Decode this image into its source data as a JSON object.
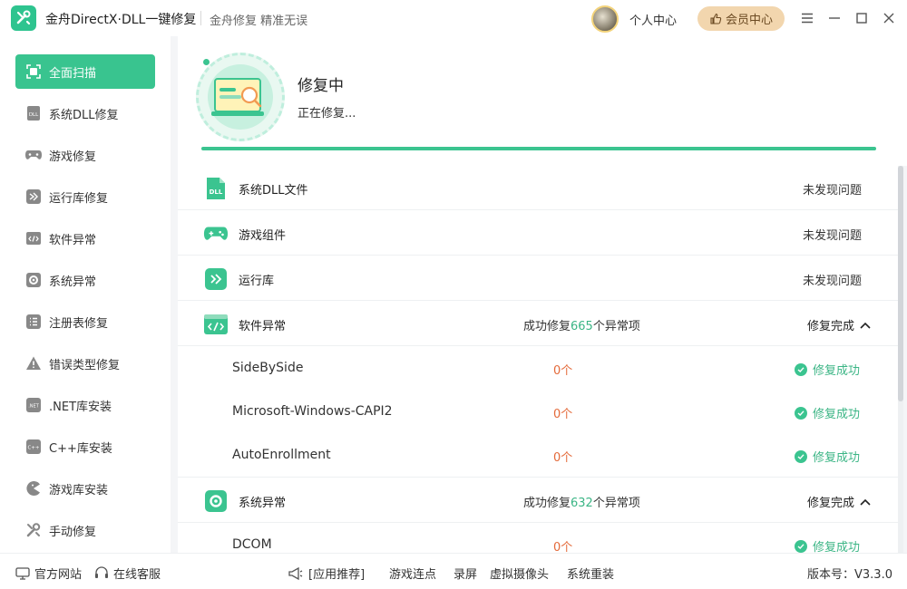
{
  "app": {
    "title": "金舟DirectX·DLL一键修复",
    "slogan": "金舟修复 精准无误",
    "personal_center": "个人中心",
    "vip_center": "会员中心",
    "accent_color": "#39c48f"
  },
  "window_controls": [
    "menu-icon",
    "minimize-icon",
    "maximize-icon",
    "close-icon"
  ],
  "sidebar": {
    "items": [
      {
        "label": "全面扫描",
        "icon": "scan-icon",
        "active": true
      },
      {
        "label": "系统DLL修复",
        "icon": "dll-icon"
      },
      {
        "label": "游戏修复",
        "icon": "gamepad-icon"
      },
      {
        "label": "运行库修复",
        "icon": "runtime-icon"
      },
      {
        "label": "软件异常",
        "icon": "code-icon"
      },
      {
        "label": "系统异常",
        "icon": "gear-icon"
      },
      {
        "label": "注册表修复",
        "icon": "list-icon"
      },
      {
        "label": "错误类型修复",
        "icon": "warning-icon"
      },
      {
        "label": ".NET库安装",
        "icon": "net-icon"
      },
      {
        "label": "C++库安装",
        "icon": "cpp-icon"
      },
      {
        "label": "游戏库安装",
        "icon": "pacman-icon"
      },
      {
        "label": "手动修复",
        "icon": "wrench-icon"
      }
    ]
  },
  "status": {
    "title": "修复中",
    "subtitle": "正在修复...",
    "progress": 1.0
  },
  "categories": [
    {
      "name": "系统DLL文件",
      "icon": "dll-file-icon",
      "status": "未发现问题"
    },
    {
      "name": "游戏组件",
      "icon": "gamepad-icon",
      "status": "未发现问题"
    },
    {
      "name": "运行库",
      "icon": "runtime-icon",
      "status": "未发现问题"
    }
  ],
  "software_group": {
    "name": "软件异常",
    "icon": "code-icon",
    "summary_prefix": "成功修复",
    "summary_count": "665",
    "summary_suffix": "个异常项",
    "status": "修复完成",
    "items": [
      {
        "name": "SideBySide",
        "count": "0个",
        "result": "修复成功"
      },
      {
        "name": "Microsoft-Windows-CAPI2",
        "count": "0个",
        "result": "修复成功"
      },
      {
        "name": "AutoEnrollment",
        "count": "0个",
        "result": "修复成功"
      }
    ]
  },
  "system_group": {
    "name": "系统异常",
    "icon": "gear-icon",
    "summary_prefix": "成功修复",
    "summary_count": "632",
    "summary_suffix": "个异常项",
    "status": "修复完成",
    "items": [
      {
        "name": "DCOM",
        "count": "0个",
        "result": "修复成功"
      }
    ]
  },
  "footer": {
    "official_site": "官方网站",
    "online_service": "在线客服",
    "app_recommend": "[应用推荐]",
    "links": [
      "游戏连点",
      "录屏",
      "虚拟摄像头",
      "系统重装"
    ],
    "version": "版本号：V3.3.0"
  }
}
